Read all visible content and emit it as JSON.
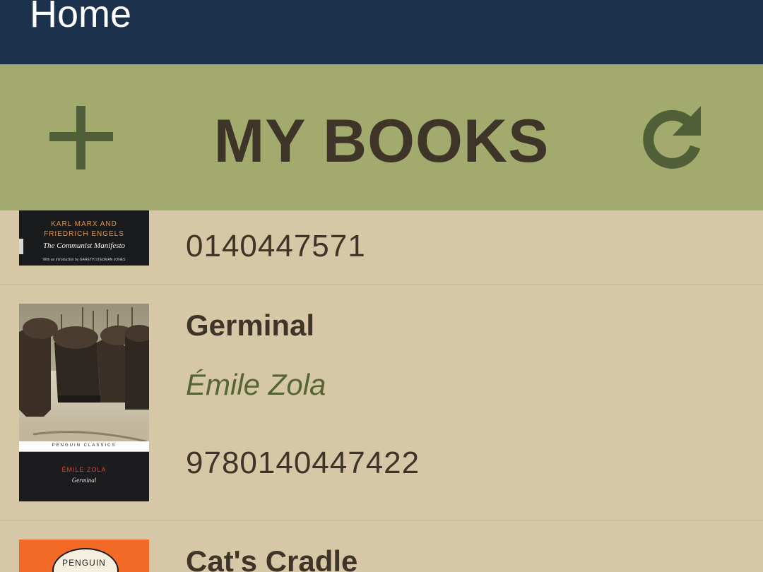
{
  "app_bar": {
    "title": "Home"
  },
  "toolbar": {
    "title": "MY BOOKS",
    "add_icon": "plus-icon",
    "refresh_icon": "refresh-icon"
  },
  "books": [
    {
      "isbn": "0140447571",
      "cover": {
        "line1": "KARL MARX AND",
        "line2": "FRIEDRICH ENGELS",
        "line3": "The Communist Manifesto",
        "line4": "With an introduction by GARETH STEDMAN JONES"
      }
    },
    {
      "title": "Germinal",
      "author": "Émile Zola",
      "isbn": "9780140447422",
      "cover": {
        "band": "PENGUIN  CLASSICS",
        "author": "ÉMILE ZOLA",
        "title": "Germinal"
      }
    },
    {
      "title": "Cat's Cradle",
      "cover": {
        "publisher": "PENGUIN"
      }
    }
  ],
  "colors": {
    "app_bar": "#1b314c",
    "toolbar": "#a3aa6d",
    "background": "#d6c7a6",
    "title_text": "#3e3528",
    "author_text": "#566535",
    "icon": "#505f37"
  }
}
